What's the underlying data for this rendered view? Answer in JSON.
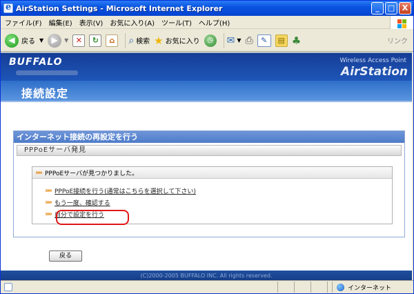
{
  "window": {
    "title": "AirStation Settings - Microsoft Internet Explorer",
    "buttons": {
      "minimize": "_",
      "maximize": "□",
      "close": "X"
    }
  },
  "menubar": {
    "items": [
      {
        "label": "ファイル(F)"
      },
      {
        "label": "編集(E)"
      },
      {
        "label": "表示(V)"
      },
      {
        "label": "お気に入り(A)"
      },
      {
        "label": "ツール(T)"
      },
      {
        "label": "ヘルプ(H)"
      }
    ]
  },
  "toolbar": {
    "back_label": "戻る",
    "search_label": "検索",
    "favorites_label": "お気に入り",
    "links_label": "リンク"
  },
  "header": {
    "brand": "BUFFALO",
    "product_tag": "Wireless Access Point",
    "product_name": "AirStation"
  },
  "page": {
    "title": "接続設定",
    "panel_title": "インターネット接続の再設定を行う",
    "sub_title": "PPPoEサーバ発見",
    "message": "PPPoEサーバが見つかりました。",
    "options": [
      {
        "label": "PPPoE接続を行う(通常はこちらを選択して下さい)"
      },
      {
        "label": "もう一度、確認する"
      },
      {
        "label": "自分で設定を行う"
      }
    ],
    "back_button": "戻る",
    "footer": "(C)2000-2005 BUFFALO INC. All rights reserved."
  },
  "statusbar": {
    "zone_label": "インターネット"
  },
  "colors": {
    "titlebar": "#0a55e0",
    "header": "#1e56b8",
    "accent_arrow": "#e38a13",
    "highlight": "#e01616"
  }
}
